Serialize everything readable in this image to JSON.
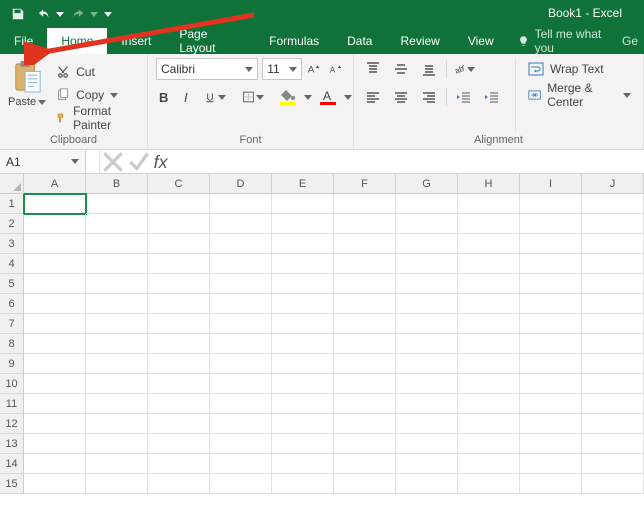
{
  "title": "Book1 - Excel",
  "qat": {
    "save": "Save",
    "undo": "Undo",
    "redo": "Redo",
    "custom": "Customize"
  },
  "tabs": {
    "file": "File",
    "home": "Home",
    "insert": "Insert",
    "page_layout": "Page Layout",
    "formulas": "Formulas",
    "data": "Data",
    "review": "Review",
    "view": "View",
    "tellme": "Tell me what you"
  },
  "clipboard": {
    "paste": "Paste",
    "cut": "Cut",
    "copy": "Copy",
    "format_painter": "Format Painter",
    "group_label": "Clipboard"
  },
  "font": {
    "name": "Calibri",
    "size": "11",
    "group_label": "Font",
    "fill_color": "#ffff00",
    "font_color": "#ff0000"
  },
  "alignment": {
    "wrap": "Wrap Text",
    "merge": "Merge & Center",
    "group_label": "Alignment"
  },
  "namebox": "A1",
  "columns": [
    "A",
    "B",
    "C",
    "D",
    "E",
    "F",
    "G",
    "H",
    "I",
    "J"
  ],
  "rows": [
    "1",
    "2",
    "3",
    "4",
    "5",
    "6",
    "7",
    "8",
    "9",
    "10",
    "11",
    "12",
    "13",
    "14",
    "15"
  ],
  "active_cell": "A1",
  "tellme_prefix": "Ge"
}
